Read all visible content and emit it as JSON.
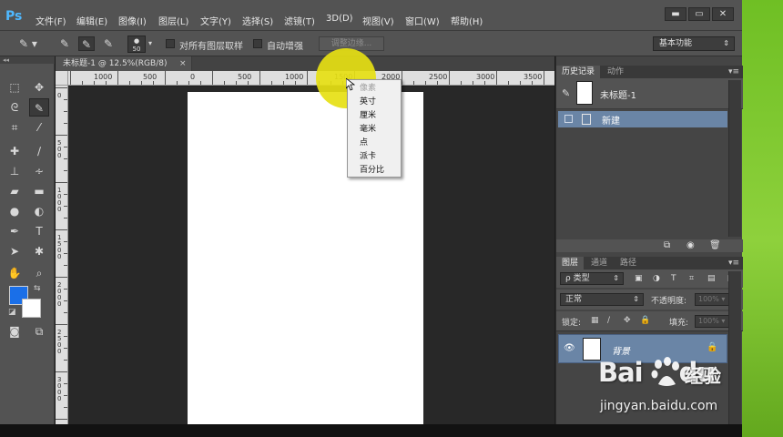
{
  "app": {
    "logo": "Ps"
  },
  "menu": [
    "文件(F)",
    "编辑(E)",
    "图像(I)",
    "图层(L)",
    "文字(Y)",
    "选择(S)",
    "滤镜(T)",
    "3D(D)",
    "视图(V)",
    "窗口(W)",
    "帮助(H)"
  ],
  "window_controls": {
    "minimize": "▬",
    "maximize": "▭",
    "close": "✕"
  },
  "options": {
    "brush_size": "50",
    "sample_all_layers": "对所有图层取样",
    "auto_enhance": "自动增强",
    "refine_edge": "调整边缘...",
    "workspace": "基本功能"
  },
  "document": {
    "tab_title": "未标题-1 @ 12.5%(RGB/8)",
    "tab_close": "×",
    "hruler_labels": [
      "1000",
      "500",
      "0",
      "500",
      "1000",
      "1500",
      "2000",
      "2500",
      "3000",
      "3500"
    ],
    "vruler_labels": [
      "0",
      "500",
      "1000",
      "1500",
      "2000",
      "2500",
      "3000",
      "3500"
    ]
  },
  "ruler_units_menu": [
    "像素",
    "英寸",
    "厘米",
    "毫米",
    "点",
    "派卡",
    "百分比"
  ],
  "history_panel": {
    "tabs": [
      "历史记录",
      "动作"
    ],
    "snapshot_label": "未标题-1",
    "new_state": "新建"
  },
  "layers_panel": {
    "tabs": [
      "图层",
      "通道",
      "路径"
    ],
    "kind": "ρ 类型",
    "blend_mode": "正常",
    "opacity_label": "不透明度:",
    "opacity_value": "100%",
    "lock_label": "锁定:",
    "fill_label": "填充:",
    "fill_value": "100%",
    "background_layer": "背景"
  },
  "watermark": {
    "logo": "Bai",
    "logo_tail": "du",
    "suffix": "经验",
    "url": "jingyan.baidu.com"
  },
  "colors": {
    "foreground": "#1a6fe8",
    "background": "#ffffff",
    "accent": "#6a85a6"
  }
}
